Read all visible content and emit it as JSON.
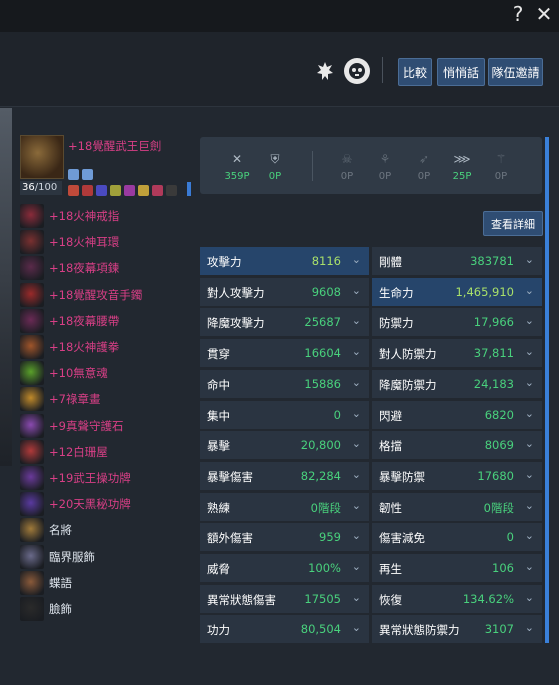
{
  "window": {
    "help_icon": "?",
    "close_icon": "✕"
  },
  "header": {
    "icons": [
      "guild-emblem-icon",
      "skull-icon"
    ],
    "buttons": [
      "比較",
      "悄悄話",
      "隊伍邀請"
    ]
  },
  "equipment": {
    "weapon": {
      "name": "+18覺醒武王巨劍",
      "level": "36",
      "max_level": "/100"
    },
    "items": [
      {
        "name": "+18火神戒指",
        "color": "#d83f86",
        "icon_color": "#8a2b3a"
      },
      {
        "name": "+18火神耳環",
        "color": "#d83f86",
        "icon_color": "#7a3030"
      },
      {
        "name": "+18夜幕項鍊",
        "color": "#d83f86",
        "icon_color": "#5a2a4a"
      },
      {
        "name": "+18覺醒攻音手鐲",
        "color": "#d83f86",
        "icon_color": "#9a2a2a"
      },
      {
        "name": "+18夜幕腰帶",
        "color": "#d83f86",
        "icon_color": "#6a2a55"
      },
      {
        "name": "+18火神護拳",
        "color": "#d83f86",
        "icon_color": "#a0552a"
      },
      {
        "name": "+10無意魂",
        "color": "#d83f86",
        "icon_color": "#5aa02a"
      },
      {
        "name": "+7祿章畫",
        "color": "#d83f86",
        "icon_color": "#c08a2a"
      },
      {
        "name": "+9真聲守護石",
        "color": "#d83f86",
        "icon_color": "#8a4ab0"
      },
      {
        "name": "+12白珊屋",
        "color": "#d83f86",
        "icon_color": "#b03a3a"
      },
      {
        "name": "+19武王操功牌",
        "color": "#d83f86",
        "icon_color": "#6a3a9a"
      },
      {
        "name": "+20天黑秘功牌",
        "color": "#d83f86",
        "icon_color": "#5a3aa0"
      },
      {
        "name": "名將",
        "color": "#dfe6ee",
        "icon_color": "#a07a3a"
      },
      {
        "name": "臨界服飾",
        "color": "#dfe6ee",
        "icon_color": "#6a6a8a"
      },
      {
        "name": "蝶語",
        "color": "#dfe6ee",
        "icon_color": "#8a5a3a"
      },
      {
        "name": "臉飾",
        "color": "#dfe6ee",
        "icon_color": "#2a2a2a"
      }
    ]
  },
  "gauges": [
    {
      "icon": "✕",
      "value": "359P",
      "active": true
    },
    {
      "icon": "⛨",
      "value": "0P",
      "active": true
    },
    {
      "icon": "☠",
      "value": "0P",
      "active": false
    },
    {
      "icon": "⚘",
      "value": "0P",
      "active": false
    },
    {
      "icon": "➶",
      "value": "0P",
      "active": false
    },
    {
      "icon": "⋙",
      "value": "25P",
      "active": true
    },
    {
      "icon": "⚚",
      "value": "0P",
      "active": false
    }
  ],
  "detail_button": "查看詳細",
  "stats_left": [
    {
      "label": "攻擊力",
      "value": "8116",
      "hl": true
    },
    {
      "label": "對人攻擊力",
      "value": "9608",
      "hl": false
    },
    {
      "label": "降魔攻擊力",
      "value": "25687",
      "hl": false
    },
    {
      "label": "貫穿",
      "value": "16604",
      "hl": false
    },
    {
      "label": "命中",
      "value": "15886",
      "hl": false
    },
    {
      "label": "集中",
      "value": "0",
      "hl": false
    },
    {
      "label": "暴擊",
      "value": "20,800",
      "hl": false
    },
    {
      "label": "暴擊傷害",
      "value": "82,284",
      "hl": false
    },
    {
      "label": "熟練",
      "value": "0階段",
      "hl": false
    },
    {
      "label": "額外傷害",
      "value": "959",
      "hl": false
    },
    {
      "label": "威脅",
      "value": "100%",
      "hl": false
    },
    {
      "label": "異常狀態傷害",
      "value": "17505",
      "hl": false
    },
    {
      "label": "功力",
      "value": "80,504",
      "hl": false
    }
  ],
  "stats_right": [
    {
      "label": "剛體",
      "value": "383781",
      "hl": false
    },
    {
      "label": "生命力",
      "value": "1,465,910",
      "hl": true
    },
    {
      "label": "防禦力",
      "value": "17,966",
      "hl": false
    },
    {
      "label": "對人防禦力",
      "value": "37,811",
      "hl": false
    },
    {
      "label": "降魔防禦力",
      "value": "24,183",
      "hl": false
    },
    {
      "label": "閃避",
      "value": "6820",
      "hl": false
    },
    {
      "label": "格擋",
      "value": "8069",
      "hl": false
    },
    {
      "label": "暴擊防禦",
      "value": "17680",
      "hl": false
    },
    {
      "label": "韌性",
      "value": "0階段",
      "hl": false
    },
    {
      "label": "傷害減免",
      "value": "0",
      "hl": false
    },
    {
      "label": "再生",
      "value": "106",
      "hl": false
    },
    {
      "label": "恢復",
      "value": "134.62%",
      "hl": false
    },
    {
      "label": "異常狀態防禦力",
      "value": "3107",
      "hl": false
    }
  ],
  "colors": {
    "value_normal": "#49d17d",
    "value_highlight": "#a9e06a",
    "row_dark": "#2a3441",
    "row_highlight": "#26456b"
  }
}
